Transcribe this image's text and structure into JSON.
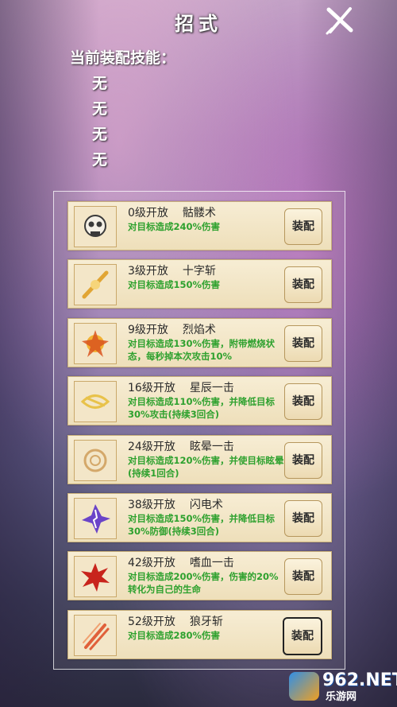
{
  "title": "招式",
  "equipped": {
    "label": "当前装配技能：",
    "slots": [
      "无",
      "无",
      "无",
      "无"
    ]
  },
  "skills": [
    {
      "level": "0级开放",
      "name": "骷髅术",
      "desc": "对目标造成240%伤害",
      "button": "装配",
      "icon": "skull-icon",
      "color": "#3a3a3a"
    },
    {
      "level": "3级开放",
      "name": "十字斩",
      "desc": "对目标造成150%伤害",
      "button": "装配",
      "icon": "cross-slash-icon",
      "color": "#e1a534"
    },
    {
      "level": "9级开放",
      "name": "烈焰术",
      "desc": "对目标造成130%伤害，附带燃烧状态，每秒掉本次攻击10%",
      "button": "装配",
      "icon": "flame-icon",
      "color": "#d9531e"
    },
    {
      "level": "16级开放",
      "name": "星辰一击",
      "desc": "对目标造成110%伤害，并降低目标30%攻击(持续3回合)",
      "button": "装配",
      "icon": "star-strike-icon",
      "color": "#e8c24a"
    },
    {
      "level": "24级开放",
      "name": "眩晕一击",
      "desc": "对目标造成120%伤害，并使目标眩晕(持续1回合)",
      "button": "装配",
      "icon": "dizzy-strike-icon",
      "color": "#d4a86a"
    },
    {
      "level": "38级开放",
      "name": "闪电术",
      "desc": "对目标造成150%伤害，并降低目标30%防御(持续3回合)",
      "button": "装配",
      "icon": "lightning-icon",
      "color": "#6a44c8"
    },
    {
      "level": "42级开放",
      "name": "嗜血一击",
      "desc": "对目标造成200%伤害，伤害的20%转化为自己的生命",
      "button": "装配",
      "icon": "blood-strike-icon",
      "color": "#c8241c"
    },
    {
      "level": "52级开放",
      "name": "狼牙斩",
      "desc": "对目标造成280%伤害",
      "button": "装配",
      "icon": "wolf-fang-icon",
      "color": "#e0603a"
    }
  ],
  "watermark": {
    "brand": "962.NET",
    "sub": "乐游网"
  }
}
